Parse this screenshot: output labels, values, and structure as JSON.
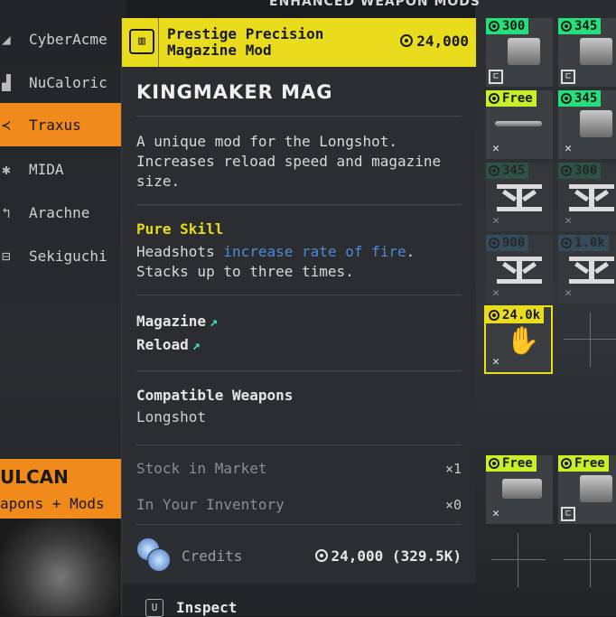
{
  "section_title": "ENHANCED WEAPON MODS",
  "factions": [
    {
      "name": "CyberAcme",
      "icon": "cyberacme-icon",
      "active": false
    },
    {
      "name": "NuCaloric",
      "icon": "nucaloric-icon",
      "active": false
    },
    {
      "name": "Traxus",
      "icon": "traxus-icon",
      "active": true
    },
    {
      "name": "MIDA",
      "icon": "mida-icon",
      "active": false
    },
    {
      "name": "Arachne",
      "icon": "arachne-icon",
      "active": false
    },
    {
      "name": "Sekiguchi",
      "icon": "sekiguchi-icon",
      "active": false
    }
  ],
  "vendor": {
    "name": "ULCAN",
    "subtitle": "apons + Mods"
  },
  "tooltip": {
    "header_name": "Prestige Precision\nMagazine Mod",
    "header_price": "24,000",
    "title": "KINGMAKER MAG",
    "description": "A unique mod for the Longshot. Increases reload speed and magazine size.",
    "skill_name": "Pure Skill",
    "skill_desc_pre": "Headshots ",
    "skill_desc_highlight": "increase rate of fire",
    "skill_desc_post": ". Stacks up to three times.",
    "stats": [
      "Magazine",
      "Reload"
    ],
    "compatible_title": "Compatible Weapons",
    "compatible_value": "Longshot",
    "stock_label": "Stock in Market",
    "stock_value": "×1",
    "inventory_label": "In Your Inventory",
    "inventory_value": "×0",
    "credits_label": "Credits",
    "credits_value": "24,000 (329.5K)",
    "inspect_key": "U",
    "inspect_label": "Inspect"
  },
  "grid": {
    "prices": [
      "300",
      "345",
      "Free",
      "345",
      "345",
      "300",
      "900",
      "1.0k",
      "24.0k",
      "Free",
      "Free"
    ]
  },
  "colors": {
    "accent_orange": "#f08a1a",
    "accent_yellow": "#e8dc1c",
    "price_green": "#25e07a",
    "link_blue": "#4b8bd9"
  }
}
